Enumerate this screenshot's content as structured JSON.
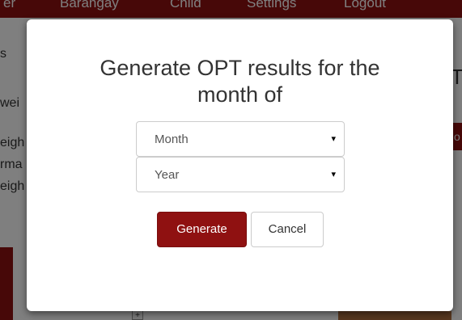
{
  "background": {
    "nav": {
      "left_partial": "er",
      "items": [
        "Barangay",
        "Child",
        "Settings",
        "Logout"
      ]
    },
    "sidebar_fragments": [
      "s",
      "wei",
      "eigh",
      "rma",
      "eigh"
    ],
    "right_fragments": {
      "heading": "T",
      "button": "o"
    },
    "plus_label": "+"
  },
  "modal": {
    "title": "Generate OPT results for the month of",
    "month_select": {
      "selected": "Month",
      "caret": "▾"
    },
    "year_select": {
      "selected": "Year",
      "caret": "▾"
    },
    "generate_label": "Generate",
    "cancel_label": "Cancel"
  },
  "colors": {
    "brand": "#8f1111",
    "overlay": "rgba(0,0,0,0.5)"
  }
}
